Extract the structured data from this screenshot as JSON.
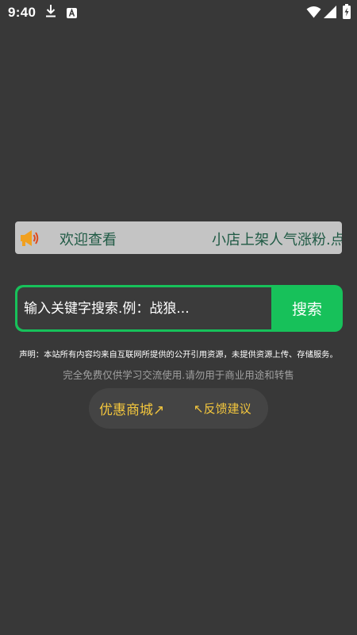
{
  "status_bar": {
    "time": "9:40",
    "icons": [
      "download-icon",
      "a-notification-icon",
      "wifi-icon",
      "signal-icon",
      "battery-charging-icon"
    ]
  },
  "marquee": {
    "icon": "megaphone-icon",
    "text_left": "欢迎查看",
    "text_right": "小店上架人气涨粉.点赞"
  },
  "search": {
    "placeholder": "输入关键字搜索.例：战狼...",
    "button_label": "搜索"
  },
  "disclaimer": "声明：本站所有内容均来自互联网所提供的公开引用资源，未提供资源上传、存储服务。",
  "free_notice": "完全免费仅供学习交流使用.请勿用于商业用途和转售",
  "links": {
    "mall": "优惠商城↗",
    "feedback": "↖反馈建议"
  },
  "colors": {
    "background": "#383838",
    "accent_green": "#17c15a",
    "link_yellow": "#f3c63d",
    "marquee_bg": "#c4c4c4",
    "marquee_text": "#1f5a44"
  }
}
